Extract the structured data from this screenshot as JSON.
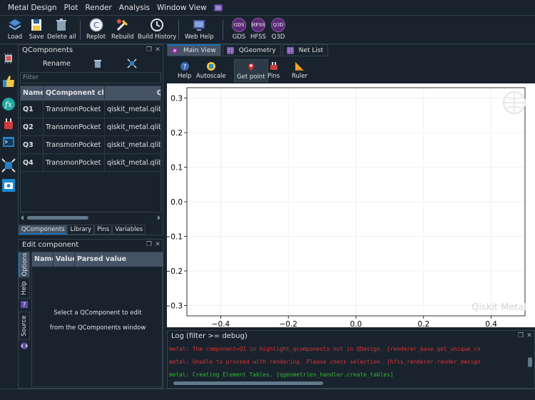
{
  "menubar": {
    "items": [
      "Metal Design",
      "Plot",
      "Render",
      "Analysis",
      "Window View"
    ]
  },
  "toolbar": {
    "load": "Load",
    "save": "Save",
    "delete_all": "Delete all",
    "replot": "Replot",
    "rebuild": "Rebuild",
    "build_history": "Build History",
    "web_help": "Web Help",
    "gds": "GDS",
    "hfss": "HFSS",
    "q3d": "Q3D",
    "gds_badge": "GDS",
    "hfss_badge": "HFSS",
    "q3d_badge": "Q3D"
  },
  "qcomponents": {
    "title": "QComponents",
    "rename": "Rename",
    "filter_placeholder": "Filter",
    "columns": [
      "Name",
      "QComponent class",
      "QComp"
    ],
    "rows": [
      {
        "name": "Q1",
        "class": "TransmonPocket",
        "module": "qiskit_metal.qlibra"
      },
      {
        "name": "Q2",
        "class": "TransmonPocket",
        "module": "qiskit_metal.qlibra"
      },
      {
        "name": "Q3",
        "class": "TransmonPocket",
        "module": "qiskit_metal.qlibra"
      },
      {
        "name": "Q4",
        "class": "TransmonPocket",
        "module": "qiskit_metal.qlibra"
      }
    ],
    "tabs": [
      "QComponents",
      "Library",
      "Pins",
      "Variables"
    ]
  },
  "edit_component": {
    "title": "Edit component",
    "columns": [
      "Name",
      "Value",
      "Parsed value"
    ],
    "side_tabs": [
      "Options",
      "Help",
      "Source"
    ],
    "message_line1": "Select a QComponent to edit",
    "message_line2": "from the QComponents window"
  },
  "main_tabs": [
    "Main View",
    "QGeometry",
    "Net List"
  ],
  "view_toolbar": {
    "help": "Help",
    "autoscale": "Autoscale",
    "get_point": "Get point",
    "pins": "Pins",
    "ruler": "Ruler"
  },
  "chart_data": {
    "type": "line",
    "title": "",
    "xlabel": "",
    "ylabel": "",
    "xlim": [
      -0.5,
      0.5
    ],
    "ylim": [
      -0.33,
      0.33
    ],
    "xticks": [
      -0.4,
      -0.2,
      0.0,
      0.2,
      0.4
    ],
    "xtick_labels": [
      "−0.4",
      "−0.2",
      "0.0",
      "0.2",
      "0.4"
    ],
    "yticks": [
      0.3,
      0.2,
      0.1,
      0.0,
      -0.1,
      -0.2,
      -0.3
    ],
    "ytick_labels": [
      "0.3",
      "0.2",
      "0.1",
      "0.0",
      "−0.1",
      "−0.2",
      "−0.3"
    ],
    "grid": true,
    "series": [],
    "watermark": "Qiskit Metal"
  },
  "log": {
    "title": "Log  (filter >= debug)",
    "lines": [
      {
        "level": "error",
        "text": "metal: The component=Q1 in highlight_qcomponents not in QDesign. [renderer_base.get_unique_co"
      },
      {
        "level": "error",
        "text": "metal: Unable to proceed with rendering. Please check selection. [hfss_renderer.render_design"
      },
      {
        "level": "info",
        "text": "metal: Creating Element Tables. [qgeometries_handler.create_tables]"
      }
    ]
  },
  "colors": {
    "background": "#19232d",
    "panel_border": "#32414b",
    "header": "#455364",
    "accent": "#1a72bb",
    "log_error": "#e03030",
    "log_info": "#2fb82f",
    "badge": "#5a2a75"
  }
}
